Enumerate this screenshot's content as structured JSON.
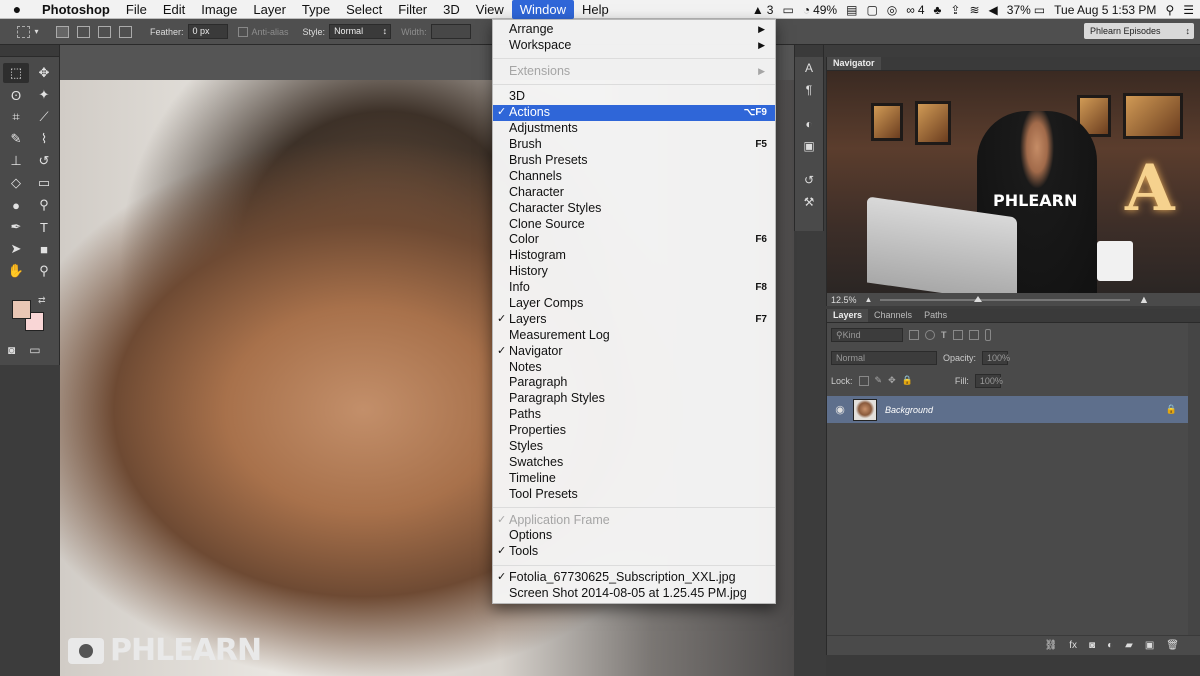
{
  "menubar": {
    "apple": "",
    "items": [
      {
        "label": "Photoshop",
        "bold": true
      },
      {
        "label": "File"
      },
      {
        "label": "Edit"
      },
      {
        "label": "Image"
      },
      {
        "label": "Layer"
      },
      {
        "label": "Type"
      },
      {
        "label": "Select"
      },
      {
        "label": "Filter"
      },
      {
        "label": "3D"
      },
      {
        "label": "View"
      },
      {
        "label": "Window",
        "active": true
      },
      {
        "label": "Help"
      }
    ],
    "status": {
      "adobe_count": "3",
      "battery_app_pct": "49%",
      "cc_count": "4",
      "battery_pct": "37%",
      "clock": "Tue Aug 5  1:53 PM"
    }
  },
  "options_bar": {
    "feather_label": "Feather:",
    "feather_value": "0 px",
    "antialias_label": "Anti-alias",
    "style_label": "Style:",
    "style_value": "Normal",
    "width_label": "Width:",
    "workspace": "Phlearn Episodes"
  },
  "window_menu": {
    "items": [
      {
        "type": "item",
        "label": "Arrange",
        "submenu": true
      },
      {
        "type": "item",
        "label": "Workspace",
        "submenu": true
      },
      {
        "type": "sep"
      },
      {
        "type": "item",
        "label": "Extensions",
        "submenu": true,
        "disabled": true
      },
      {
        "type": "sep"
      },
      {
        "type": "item",
        "label": "3D"
      },
      {
        "type": "item",
        "label": "Actions",
        "checked": true,
        "highlighted": true,
        "shortcut": "⌥F9"
      },
      {
        "type": "item",
        "label": "Adjustments"
      },
      {
        "type": "item",
        "label": "Brush",
        "shortcut": "F5"
      },
      {
        "type": "item",
        "label": "Brush Presets"
      },
      {
        "type": "item",
        "label": "Channels"
      },
      {
        "type": "item",
        "label": "Character"
      },
      {
        "type": "item",
        "label": "Character Styles"
      },
      {
        "type": "item",
        "label": "Clone Source"
      },
      {
        "type": "item",
        "label": "Color",
        "shortcut": "F6"
      },
      {
        "type": "item",
        "label": "Histogram"
      },
      {
        "type": "item",
        "label": "History"
      },
      {
        "type": "item",
        "label": "Info",
        "shortcut": "F8"
      },
      {
        "type": "item",
        "label": "Layer Comps"
      },
      {
        "type": "item",
        "label": "Layers",
        "checked": true,
        "shortcut": "F7"
      },
      {
        "type": "item",
        "label": "Measurement Log"
      },
      {
        "type": "item",
        "label": "Navigator",
        "checked": true
      },
      {
        "type": "item",
        "label": "Notes"
      },
      {
        "type": "item",
        "label": "Paragraph"
      },
      {
        "type": "item",
        "label": "Paragraph Styles"
      },
      {
        "type": "item",
        "label": "Paths"
      },
      {
        "type": "item",
        "label": "Properties"
      },
      {
        "type": "item",
        "label": "Styles"
      },
      {
        "type": "item",
        "label": "Swatches"
      },
      {
        "type": "item",
        "label": "Timeline"
      },
      {
        "type": "item",
        "label": "Tool Presets"
      },
      {
        "type": "sep"
      },
      {
        "type": "item",
        "label": "Application Frame",
        "checked": true,
        "disabled": true
      },
      {
        "type": "item",
        "label": "Options"
      },
      {
        "type": "item",
        "label": "Tools",
        "checked": true
      },
      {
        "type": "sep"
      },
      {
        "type": "item",
        "label": "Fotolia_67730625_Subscription_XXL.jpg",
        "checked": true
      },
      {
        "type": "item",
        "label": "Screen Shot 2014-08-05 at 1.25.45 PM.jpg"
      }
    ]
  },
  "navigator": {
    "title": "Navigator",
    "zoom": "12.5%",
    "shirt_text": "PHLEARN",
    "sign_letter": "A"
  },
  "layers_panel": {
    "tabs": [
      "Layers",
      "Channels",
      "Paths"
    ],
    "filter_kind": "Kind",
    "blend_mode": "Normal",
    "opacity_label": "Opacity:",
    "opacity_value": "100%",
    "lock_label": "Lock:",
    "fill_label": "Fill:",
    "fill_value": "100%",
    "layer_name": "Background"
  },
  "canvas": {
    "watermark": "PHLEARN"
  }
}
